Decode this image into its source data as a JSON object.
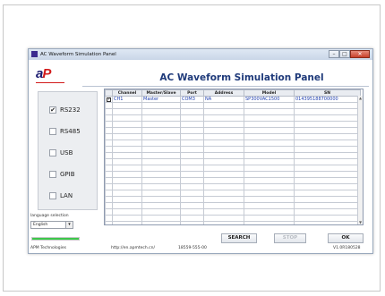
{
  "window": {
    "title": "AC Waveform Simulation Panel",
    "min_glyph": "–",
    "max_glyph": "□",
    "close_glyph": "✕"
  },
  "logo": {
    "text_a": "a",
    "text_b": "P"
  },
  "header": {
    "title": "AC Waveform Simulation Panel"
  },
  "interfaces": [
    {
      "label": "RS232",
      "checked": true
    },
    {
      "label": "RS485",
      "checked": false
    },
    {
      "label": "USB",
      "checked": false
    },
    {
      "label": "GPIB",
      "checked": false
    },
    {
      "label": "LAN",
      "checked": false
    }
  ],
  "language": {
    "label": "language selection",
    "value": "English",
    "arrow": "▾"
  },
  "progress": {
    "value": 1.0,
    "color": "#3cc84a"
  },
  "table": {
    "columns": [
      "",
      "Channel",
      "Master/Slave",
      "Port",
      "Address",
      "Model",
      "SN"
    ],
    "rows": [
      {
        "checked": true,
        "channel": "CH1",
        "role": "Master",
        "port": "COM3",
        "address": "NA",
        "model": "SP300VAC1500",
        "sn": "014395188700000"
      }
    ],
    "empty_rows": 22
  },
  "buttons": {
    "search": "SEARCH",
    "stop": "STOP",
    "ok": "OK"
  },
  "footer": {
    "company": "APM Technologies",
    "url": "http://en.apmtech.cn/",
    "phone": "18559-555-00",
    "version": "V1.0R180528"
  },
  "colors": {
    "title": "#1f3a7a",
    "cell_text": "#1f3fb0",
    "logo_blue": "#1a1a70",
    "logo_red": "#d21b1b"
  }
}
